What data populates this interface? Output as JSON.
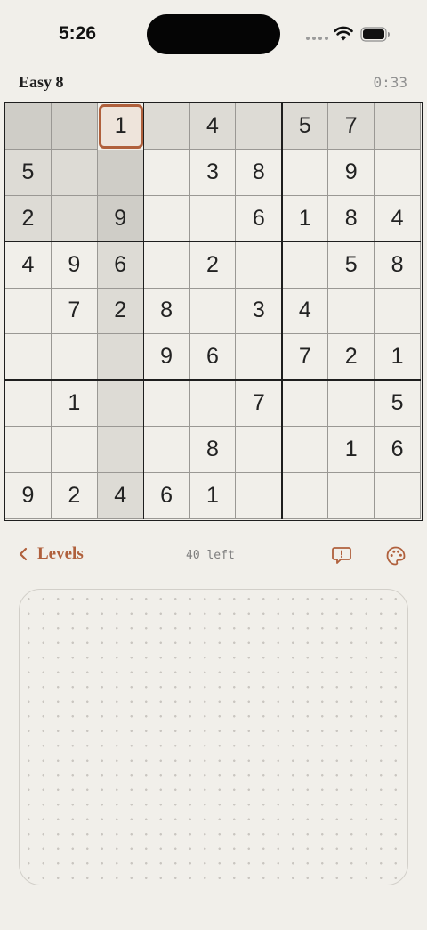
{
  "status_bar": {
    "time": "5:26"
  },
  "header": {
    "title": "Easy 8",
    "timer": "0:33"
  },
  "board": {
    "selected": [
      0,
      2
    ],
    "highlight_row": 0,
    "highlight_col": 2,
    "highlight_box": [
      0,
      0
    ],
    "cells": [
      [
        "",
        "",
        "1",
        "",
        "4",
        "",
        "5",
        "7",
        ""
      ],
      [
        "5",
        "",
        "",
        "",
        "3",
        "8",
        "",
        "9",
        ""
      ],
      [
        "2",
        "",
        "9",
        "",
        "",
        "6",
        "1",
        "8",
        "4"
      ],
      [
        "4",
        "9",
        "6",
        "",
        "2",
        "",
        "",
        "5",
        "8"
      ],
      [
        "",
        "7",
        "2",
        "8",
        "",
        "3",
        "4",
        "",
        ""
      ],
      [
        "",
        "",
        "",
        "9",
        "6",
        "",
        "7",
        "2",
        "1"
      ],
      [
        "",
        "1",
        "",
        "",
        "",
        "7",
        "",
        "",
        "5"
      ],
      [
        "",
        "",
        "",
        "",
        "8",
        "",
        "",
        "1",
        "6"
      ],
      [
        "9",
        "2",
        "4",
        "6",
        "1",
        "",
        "",
        "",
        ""
      ]
    ]
  },
  "toolbar": {
    "levels_label": "Levels",
    "remaining": "40 left",
    "back_icon": "chevron-left-icon",
    "feedback_icon": "feedback-bubble-icon",
    "theme_icon": "palette-icon"
  },
  "colors": {
    "accent": "#B0603C",
    "background": "#F1EFEA",
    "highlight": "#DDDBD5",
    "selected_fill": "#EEE4DB"
  }
}
